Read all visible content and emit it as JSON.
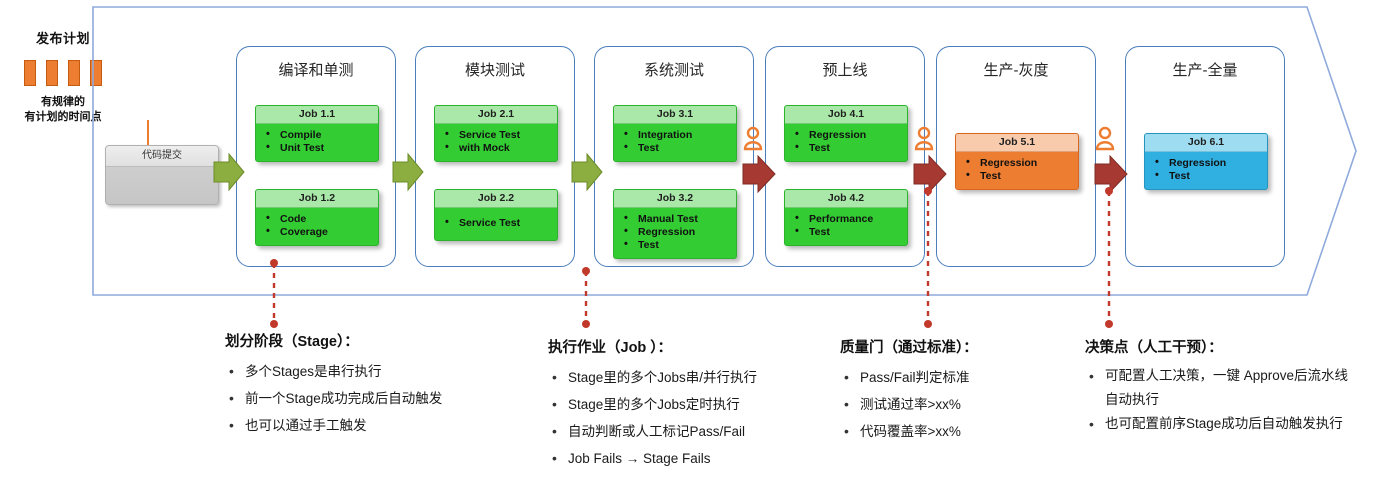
{
  "release_plan": {
    "title": "发布计划",
    "bars": 4,
    "subtitle_line1": "有规律的",
    "subtitle_line2": "有计划的时间点",
    "bar_color": "#ED7D31"
  },
  "code_commit": {
    "label": "代码提交"
  },
  "pipeline": {
    "frame_color": "#8FAADC",
    "stage_border_color": "#4A7EBB",
    "stages": [
      {
        "name": "编译和单测",
        "jobs": [
          {
            "title": "Job 1.1",
            "color": "green",
            "items": [
              "Compile",
              "Unit Test"
            ]
          },
          {
            "title": "Job 1.2",
            "color": "green",
            "items": [
              "Code",
              "Coverage"
            ]
          }
        ]
      },
      {
        "name": "模块测试",
        "jobs": [
          {
            "title": "Job 2.1",
            "color": "green",
            "items": [
              "Service Test",
              "with Mock"
            ]
          },
          {
            "title": "Job 2.2",
            "color": "green",
            "items": [
              "Service Test"
            ]
          }
        ]
      },
      {
        "name": "系统测试",
        "jobs": [
          {
            "title": "Job 3.1",
            "color": "green",
            "items": [
              "Integration",
              "Test"
            ]
          },
          {
            "title": "Job 3.2",
            "color": "green",
            "items": [
              "Manual Test",
              "Regression",
              "Test"
            ]
          }
        ]
      },
      {
        "name": "预上线",
        "jobs": [
          {
            "title": "Job 4.1",
            "color": "green",
            "items": [
              "Regression",
              "Test"
            ]
          },
          {
            "title": "Job 4.2",
            "color": "green",
            "items": [
              "Performance",
              "Test"
            ]
          }
        ]
      },
      {
        "name": "生产-灰度",
        "jobs": [
          {
            "title": "Job 5.1",
            "color": "orange",
            "items": [
              "Regression",
              "Test"
            ]
          }
        ]
      },
      {
        "name": "生产-全量",
        "jobs": [
          {
            "title": "Job 6.1",
            "color": "blue",
            "items": [
              "Regression",
              "Test"
            ]
          }
        ]
      }
    ],
    "connectors": [
      {
        "kind": "auto-arrow",
        "color": "#8CAD3F"
      },
      {
        "kind": "auto-arrow",
        "color": "#8CAD3F"
      },
      {
        "kind": "auto-arrow",
        "color": "#8CAD3F"
      },
      {
        "kind": "manual-gate",
        "color": "#A63A32"
      },
      {
        "kind": "manual-gate",
        "color": "#A63A32"
      },
      {
        "kind": "manual-gate",
        "color": "#A63A32"
      }
    ],
    "gate_person_color": "#ED7D31"
  },
  "callouts": [
    {
      "title": "划分阶段（Stage）：",
      "items": [
        "多个Stages是串行执行",
        "前一个Stage成功完成后自动触发",
        "也可以通过手工触发"
      ]
    },
    {
      "title": "执行作业（Job ）：",
      "items": [
        "Stage里的多个Jobs串/并行执行",
        "Stage里的多个Jobs定时执行",
        "自动判断或人工标记Pass/Fail",
        "Job Fails → Stage Fails"
      ]
    },
    {
      "title": "质量门（通过标准）：",
      "items": [
        "Pass/Fail判定标准",
        "测试通过率>xx%",
        "代码覆盖率>xx%"
      ]
    },
    {
      "title": "决策点（人工干预）：",
      "items": [
        "可配置人工决策，一键 Approve后流水线自动执行",
        "也可配置前序Stage成功后自动触发执行"
      ]
    }
  ],
  "dashline_color": "#C0392B"
}
